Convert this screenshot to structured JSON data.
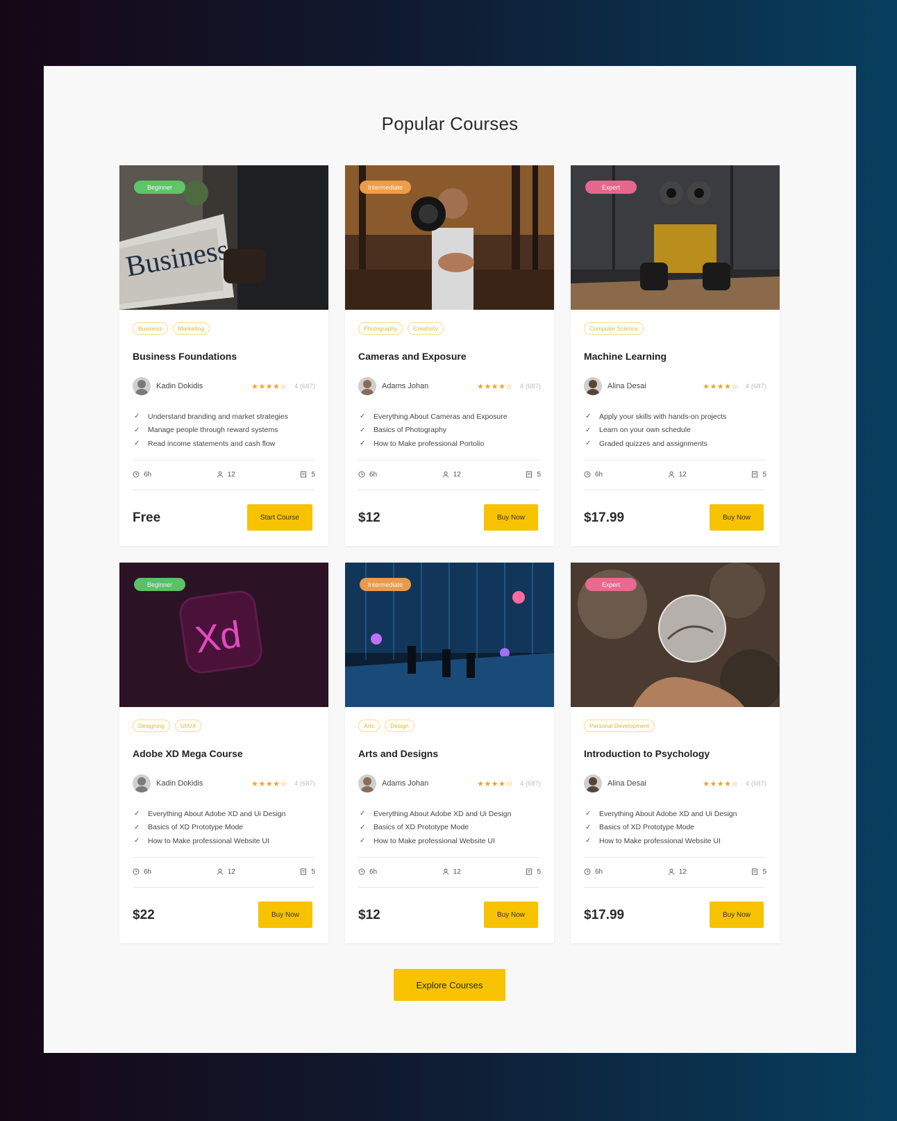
{
  "page": {
    "title": "Popular Courses",
    "explore_label": "Explore Courses"
  },
  "colors": {
    "accent": "#f7c200",
    "beginner": "#5ecb6b",
    "intermediate": "#f5a14b",
    "expert": "#f06a93",
    "star": "#f2a227"
  },
  "icons": {
    "check": "✓",
    "clock": "clock-icon",
    "user": "user-icon",
    "lessons": "lessons-icon",
    "star": "star-icon"
  },
  "courses": [
    {
      "level": "Beginner",
      "image": "business-newspaper-photo",
      "tags": [
        "Business",
        "Marketing"
      ],
      "title": "Business Foundations",
      "author": "Kadin Dokidis",
      "rating": 4,
      "rating_text": "4 (687)",
      "features": [
        "Understand branding and market strategies",
        "Manage people through reward systems",
        "Read income statements and cash flow"
      ],
      "duration": "6h",
      "students": "12",
      "lessons": "5",
      "price": "Free",
      "cta": "Start Course"
    },
    {
      "level": "Intermediate",
      "image": "camera-in-forest-photo",
      "tags": [
        "Photography",
        "Creativity"
      ],
      "title": "Cameras and Exposure",
      "author": "Adams Johan",
      "rating": 4,
      "rating_text": "4 (687)",
      "features": [
        "Everything About Cameras and Exposure",
        "Basics of Photography",
        "How to Make professional Portolio"
      ],
      "duration": "6h",
      "students": "12",
      "lessons": "5",
      "price": "$12",
      "cta": "Buy Now"
    },
    {
      "level": "Expert",
      "image": "robot-toy-photo",
      "tags": [
        "Computer Science"
      ],
      "title": "Machine Learning",
      "author": "Alina Desai",
      "rating": 4,
      "rating_text": "4 (687)",
      "features": [
        "Apply your skills with hands-on projects",
        "Learn on your own schedule",
        "Graded quizzes and assignments"
      ],
      "duration": "6h",
      "students": "12",
      "lessons": "5",
      "price": "$17.99",
      "cta": "Buy Now"
    },
    {
      "level": "Beginner",
      "image": "adobe-xd-logo-render",
      "tags": [
        "Designing",
        "UI/UX"
      ],
      "title": "Adobe XD Mega Course",
      "author": "Kadin Dokidis",
      "rating": 4,
      "rating_text": "4 (687)",
      "features": [
        "Everything About Adobe XD and Ui Design",
        "Basics of XD Prototype Mode",
        "How to Make professional Website UI"
      ],
      "duration": "6h",
      "students": "12",
      "lessons": "5",
      "price": "$22",
      "cta": "Buy Now"
    },
    {
      "level": "Intermediate",
      "image": "digital-art-installation-photo",
      "tags": [
        "Arts",
        "Design"
      ],
      "title": "Arts and Designs",
      "author": "Adams Johan",
      "rating": 4,
      "rating_text": "4 (687)",
      "features": [
        "Everything About Adobe XD and Ui Design",
        "Basics of XD Prototype Mode",
        "How to Make professional Website UI"
      ],
      "duration": "6h",
      "students": "12",
      "lessons": "5",
      "price": "$12",
      "cta": "Buy Now"
    },
    {
      "level": "Expert",
      "image": "crystal-ball-hand-photo",
      "tags": [
        "Personal Development"
      ],
      "title": "Introduction to Psychology",
      "author": "Alina Desai",
      "rating": 4,
      "rating_text": "4 (687)",
      "features": [
        "Everything About Adobe XD and Ui Design",
        "Basics of XD Prototype Mode",
        "How to Make professional Website UI"
      ],
      "duration": "6h",
      "students": "12",
      "lessons": "5",
      "price": "$17.99",
      "cta": "Buy Now"
    }
  ]
}
